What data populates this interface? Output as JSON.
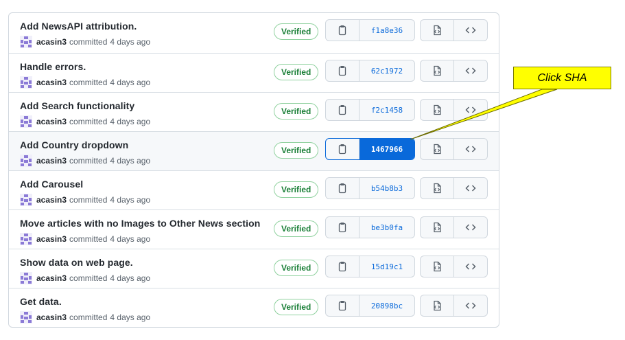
{
  "commits": [
    {
      "message": "Add NewsAPI attribution.",
      "author": "acasin3",
      "committed": "committed",
      "time": "4 days ago",
      "badge": "Verified",
      "sha": "f1a8e36",
      "active": false
    },
    {
      "message": "Handle errors.",
      "author": "acasin3",
      "committed": "committed",
      "time": "4 days ago",
      "badge": "Verified",
      "sha": "62c1972",
      "active": false
    },
    {
      "message": "Add Search functionality",
      "author": "acasin3",
      "committed": "committed",
      "time": "4 days ago",
      "badge": "Verified",
      "sha": "f2c1458",
      "active": false
    },
    {
      "message": "Add Country dropdown",
      "author": "acasin3",
      "committed": "committed",
      "time": "4 days ago",
      "badge": "Verified",
      "sha": "1467966",
      "active": true
    },
    {
      "message": "Add Carousel",
      "author": "acasin3",
      "committed": "committed",
      "time": "4 days ago",
      "badge": "Verified",
      "sha": "b54b8b3",
      "active": false
    },
    {
      "message": "Move articles with no Images to Other News section",
      "author": "acasin3",
      "committed": "committed",
      "time": "4 days ago",
      "badge": "Verified",
      "sha": "be3b0fa",
      "active": false
    },
    {
      "message": "Show data on web page.",
      "author": "acasin3",
      "committed": "committed",
      "time": "4 days ago",
      "badge": "Verified",
      "sha": "15d19c1",
      "active": false
    },
    {
      "message": "Get data.",
      "author": "acasin3",
      "committed": "committed",
      "time": "4 days ago",
      "badge": "Verified",
      "sha": "20898bc",
      "active": false
    }
  ],
  "callout": {
    "text": "Click SHA"
  },
  "icons": {
    "copy": "clipboard-icon",
    "browse": "file-code-icon",
    "code": "code-icon",
    "avatar": "identicon-avatar"
  },
  "colors": {
    "accent": "#0969da",
    "verified": "#1a7f37",
    "callout": "#ffff00",
    "avatar": "#8b7ad6"
  }
}
